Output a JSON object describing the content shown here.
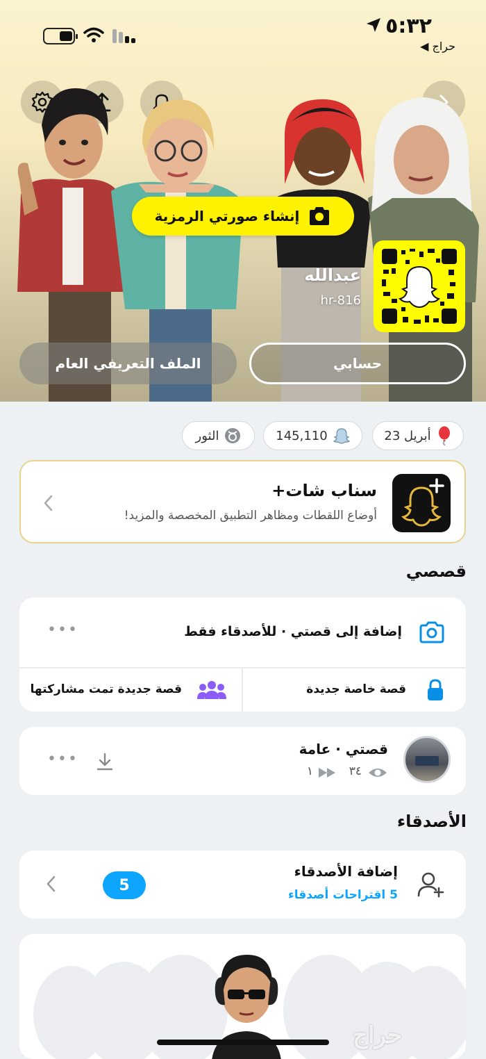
{
  "status_bar": {
    "time": "٥:٣٢",
    "back_app": "◀ حراج"
  },
  "profile": {
    "create_avatar_label": "إنشاء صورتي الرمزية",
    "display_name": "عبدالله",
    "username": "hr-816",
    "public_profile_button": "الملف التعريفي العام",
    "my_account_button": "حسابي"
  },
  "chips": {
    "birthday": "23 أبريل",
    "score": "145,110",
    "zodiac": "الثور"
  },
  "snapchat_plus": {
    "title": "سناب شات+",
    "subtitle": "أوضاع اللقطات ومظاهر التطبيق المخصصة والمزيد!"
  },
  "stories": {
    "section_title": "قصصي",
    "add_story": "إضافة إلى قصتي · للأصدقاء فقط",
    "new_private_story": "قصة خاصة جديدة",
    "new_shared_story": "قصة جديدة تمت مشاركتها",
    "my_story_title": "قصتي · عامة",
    "views": "٣٤",
    "screenshots": "١"
  },
  "friends": {
    "section_title": "الأصدقاء",
    "add_friends_title": "إضافة الأصدقاء",
    "add_friends_sub": "5 اقتراحات أصدقاء",
    "badge_count": "5"
  },
  "watermark": "حراج",
  "colors": {
    "snap_yellow": "#fff200",
    "accent_blue": "#0ea5ff",
    "story_purple": "#8b5cf6",
    "lock_blue": "#0a8fe6"
  }
}
